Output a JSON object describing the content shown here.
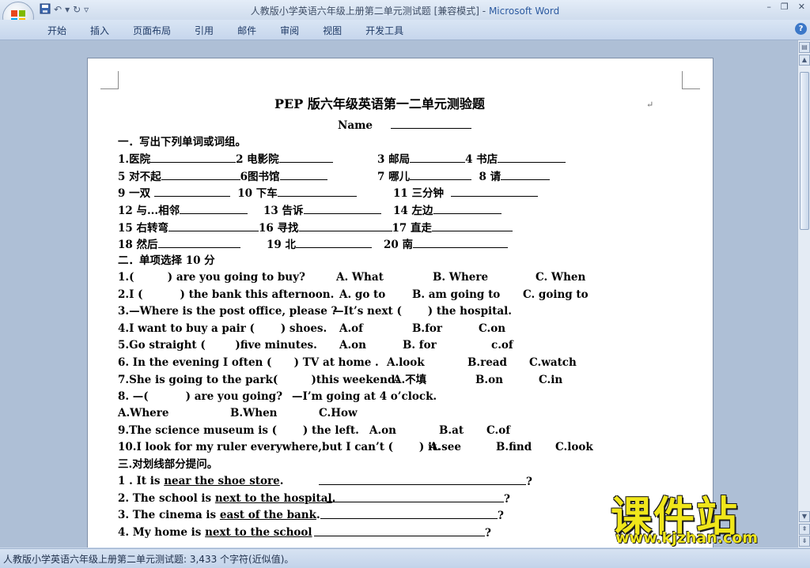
{
  "window": {
    "title": "人教版小学英语六年级上册第二单元测试题 [兼容模式]",
    "title_sep": " - ",
    "app_name": "Microsoft Word"
  },
  "ribbon": {
    "tabs": [
      "开始",
      "插入",
      "页面布局",
      "引用",
      "邮件",
      "审阅",
      "视图",
      "开发工具"
    ]
  },
  "doc": {
    "title": "PEP 版六年级英语第一二单元测验题",
    "name_label": "Name",
    "lines": [
      "一．写出下列单词或词组。",
      "1.医院",
      "2 电影院",
      "3 邮局",
      "4 书店",
      "5 对不起",
      "6图书馆",
      "7 哪儿",
      "8 请",
      "9 一双",
      "10 下车",
      "11 三分钟",
      "12 与...相邻",
      "13 告诉",
      "14 左边",
      "15 右转弯",
      "16 寻找",
      "17 直走",
      "18 然后",
      "19 北",
      "20 南",
      "二．单项选择 10 分",
      "1.(         ) are you going to buy?",
      "A. What",
      "B. Where",
      "C. When",
      "2.I (          ) the bank this afternoon.",
      "A. go to",
      "B. am going to",
      "C. going to",
      "3.—Where is the post office, please ?",
      "—It’s next (       ) the hospital.",
      "4.I want to buy a pair (       ) shoes.",
      "A.of",
      "B.for",
      "C.on",
      "5.Go straight (        )five minutes.",
      "A.on",
      "B. for",
      "c.of",
      "6. In the evening I often (      ) TV at home .",
      "A.look",
      "B.read",
      "C.watch",
      "7.She is going to the park(         )this weekend.",
      "A.不填",
      "B.on",
      "C.in",
      "8. —(          ) are you going?",
      "—I’m going at 4 o’clock.",
      "A.Where",
      "B.When",
      "C.How",
      "9.The science museum is (       ) the left.",
      "A.on",
      "B.at",
      "C.of",
      "10.I look for my ruler everywhere,but I can’t (       ) it.",
      "A.see",
      "B.find",
      "C.look",
      "三.对划线部分提问。",
      "1 . It is",
      "near the shoe store",
      "2. The school is",
      "next to the hospital",
      "3. The cinema is",
      "east of the bank",
      "4. My home is",
      "next to the school"
    ]
  },
  "status": {
    "text": "人教版小学英语六年级上册第二单元测试题: 3,433 个字符(近似值)。"
  },
  "watermark": {
    "text": "课件站",
    "url": "www.kjzhan.com"
  },
  "colors": {
    "title_app": "#2c5aa0",
    "watermark": "#f0e61a"
  }
}
